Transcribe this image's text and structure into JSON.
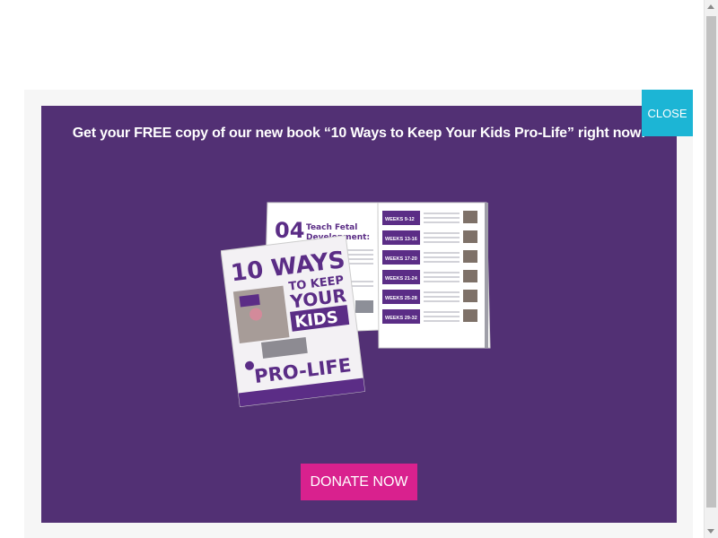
{
  "popup": {
    "title": "Get your FREE copy of our new book “10 Ways to Keep Your Kids Pro-Life” right now!",
    "close_label": "CLOSE",
    "donate_label": "DONATE NOW"
  },
  "book": {
    "cover_line1": "10 WAYS",
    "cover_line2": "TO KEEP",
    "cover_line3": "YOUR",
    "cover_line4": "KIDS",
    "cover_line5": "PRO-LIFE",
    "spread_chapter_number": "04",
    "spread_heading_line1": "Teach Fetal",
    "spread_heading_line2": "Development:",
    "weeks": [
      "WEEKS 9-12",
      "WEEKS 13-16",
      "WEEKS 17-20",
      "WEEKS 21-24",
      "WEEKS 25-28",
      "WEEKS 29-32"
    ]
  },
  "colors": {
    "modal_bg": "#523074",
    "close_bg": "#1cb5d5",
    "donate_bg": "#d9218e",
    "book_purple": "#5b2d86"
  }
}
